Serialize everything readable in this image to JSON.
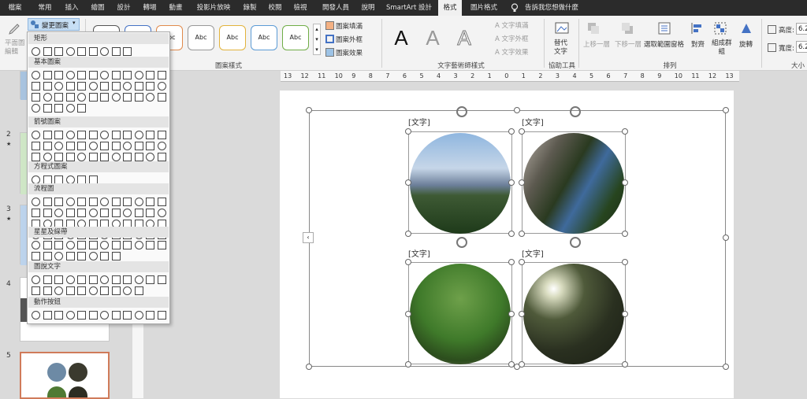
{
  "menubar": {
    "tabs": [
      "檔案",
      "常用",
      "插入",
      "繪圖",
      "設計",
      "轉場",
      "動畫",
      "投影片放映",
      "錄製",
      "校閱",
      "檢視",
      "開發人員",
      "說明",
      "SmartArt 設計",
      "格式",
      "圖片格式"
    ],
    "active_tab": "格式",
    "tell_me": "告訴我您想做什麼"
  },
  "ribbon": {
    "edit_in_2d": "平面圖\n編輯",
    "change_shape": "變更圖案",
    "style_sample": "Abc",
    "shape_fill": "圖案填滿",
    "shape_outline": "圖案外框",
    "shape_effects": "圖案效果",
    "shape_styles_label": "圖案樣式",
    "wordart_letter": "A",
    "text_fill": "文字填滿",
    "text_outline": "文字外框",
    "text_effects": "文字效果",
    "wordart_styles_label": "文字藝術師樣式",
    "alt_text": "替代\n文字",
    "accessibility_label": "協助工具",
    "bring_forward": "上移一層",
    "send_backward": "下移一層",
    "selection_pane": "選取範圍窗格",
    "align": "對齊",
    "group": "組成群\n組",
    "rotate": "旋轉",
    "arrange_label": "排列",
    "height_label": "高度:",
    "height_value": "6.2",
    "width_label": "寬度:",
    "width_value": "6.2",
    "size_label": "大小"
  },
  "shapes_panel": {
    "categories": [
      "矩形",
      "基本圖案",
      "箭號圖案",
      "方程式圖案",
      "流程圖",
      "星星及綵帶",
      "圖說文字",
      "動作按鈕"
    ]
  },
  "thumbnails": {
    "numbers": [
      "2",
      "3",
      "4",
      "5"
    ],
    "star": "★"
  },
  "ruler": {
    "ticks": [
      "13",
      "12",
      "11",
      "10",
      "9",
      "8",
      "7",
      "6",
      "5",
      "4",
      "3",
      "2",
      "1",
      "0",
      "1",
      "2",
      "3",
      "4",
      "5",
      "6",
      "7",
      "8",
      "9",
      "10",
      "11",
      "12",
      "13"
    ]
  },
  "slide": {
    "placeholder_text": "[文字]"
  },
  "colors": {
    "menubar_bg": "#2b2b2b",
    "ribbon_bg": "#f3f3f3",
    "selected_thumb_border": "#d07b5a"
  }
}
